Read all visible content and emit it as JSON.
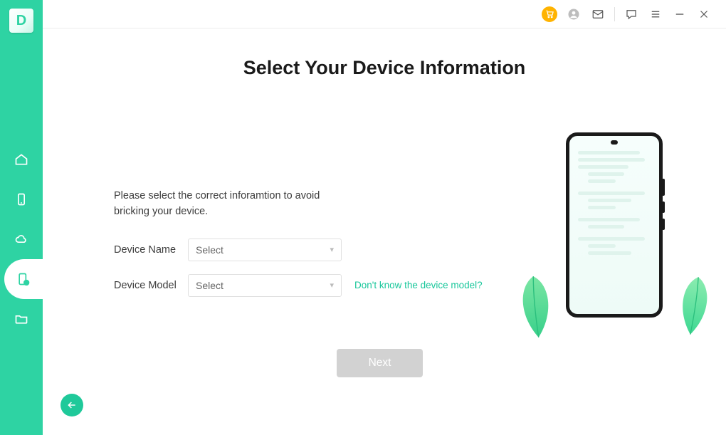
{
  "app": {
    "logo_letter": "D"
  },
  "titlebar": {
    "icons": {
      "cart": "cart-icon",
      "user": "user-icon",
      "mail": "mail-icon",
      "feedback": "feedback-icon",
      "menu": "menu-icon",
      "minimize": "minimize-icon",
      "close": "close-icon"
    }
  },
  "sidebar": {
    "items": [
      {
        "name": "home-icon"
      },
      {
        "name": "phone-icon"
      },
      {
        "name": "cloud-icon"
      },
      {
        "name": "device-alert-icon",
        "selected": true
      },
      {
        "name": "folder-icon"
      }
    ]
  },
  "main": {
    "title": "Select Your Device Information",
    "intro": "Please select the correct inforamtion to avoid bricking your device.",
    "fields": {
      "device_name": {
        "label": "Device Name",
        "placeholder": "Select"
      },
      "device_model": {
        "label": "Device Model",
        "placeholder": "Select",
        "help": "Don't know the device model?"
      }
    },
    "next_label": "Next"
  },
  "colors": {
    "accent": "#2ed3a3",
    "cart": "#ffb300"
  }
}
